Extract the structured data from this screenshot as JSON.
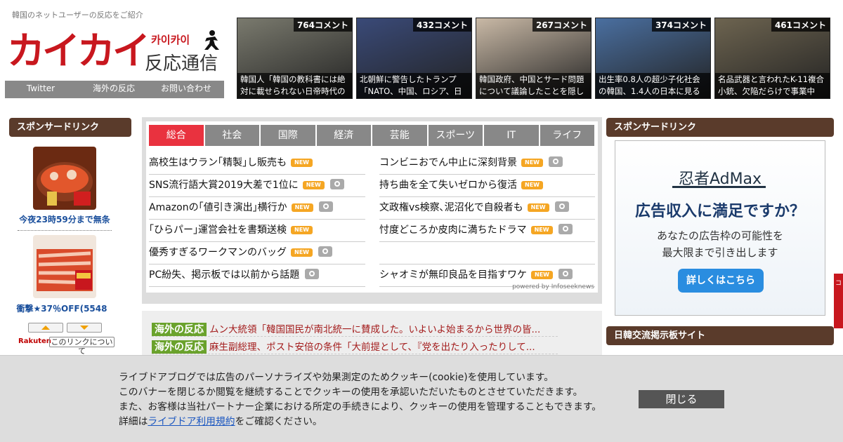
{
  "site": {
    "tagline": "韓国のネットユーザーの反応をご紹介",
    "logo_main": "カイカイ",
    "logo_kana": "카이카이",
    "logo_sub": "反応通信"
  },
  "topnav": [
    "Twitter",
    "海外の反応",
    "お問い合わせ"
  ],
  "thumbnails": [
    {
      "count": "764コメント",
      "caption": "韓国人「韓国の教科書には絶対に載せられない日帝時代の",
      "color": "#7a7a6e"
    },
    {
      "count": "432コメント",
      "caption": "北朝鮮に警告したトランプ「NATO、中国、ロシア、日",
      "color": "#3a4a78"
    },
    {
      "count": "267コメント",
      "caption": "韓国政府、中国とサード問題について議論したことを隠し",
      "color": "#c9b9a6"
    },
    {
      "count": "374コメント",
      "caption": "出生率0.8人の超少子化社会の韓国、1.4人の日本に見る",
      "color": "#4a6fa0"
    },
    {
      "count": "461コメント",
      "caption": "名品武器と言われたK-11複合小銃、欠陥だらけで事業中",
      "color": "#6d6450"
    }
  ],
  "left": {
    "header": "スポンサードリンク",
    "product1_label": "今夜23時59分まで無条",
    "product2_label": "衝撃★37％OFF(5548",
    "rakuten": "Rakuten",
    "about_link": "このリンクについて"
  },
  "news": {
    "tabs": [
      "総合",
      "社会",
      "国際",
      "経済",
      "芸能",
      "スポーツ",
      "IT",
      "ライフ"
    ],
    "active_tab": 0,
    "left_items": [
      {
        "title": "高校生はウラン｢精製｣し販売も",
        "new": true,
        "photo": false
      },
      {
        "title": "SNS流行語大賞2019大差で1位に",
        "new": true,
        "photo": true
      },
      {
        "title": "Amazonの｢値引き演出｣横行か",
        "new": true,
        "photo": true
      },
      {
        "title": "｢ひらパー｣運営会社を書類送検",
        "new": true,
        "photo": false
      },
      {
        "title": "優秀すぎるワークマンのバッグ",
        "new": true,
        "photo": true
      },
      {
        "title": "PC紛失、掲示板では以前から話題",
        "new": false,
        "photo": true
      }
    ],
    "right_items": [
      {
        "title": "コンビニおでん中止に深刻背景",
        "new": true,
        "photo": true
      },
      {
        "title": "持ち曲を全て失いゼロから復活",
        "new": true,
        "photo": false
      },
      {
        "title": "文政権vs検察､泥沼化で自殺者も",
        "new": true,
        "photo": true
      },
      {
        "title": "忖度どころか皮肉に満ちたドラマ",
        "new": true,
        "photo": true
      },
      {
        "title": "",
        "new": false,
        "photo": false
      },
      {
        "title": "シャオミが無印良品を目指すワケ",
        "new": true,
        "photo": true
      }
    ],
    "new_label": "NEW",
    "powered": "powered by Infoseeknews"
  },
  "overseas": [
    {
      "tag": "海外の反応",
      "text": "ムン大統領「韓国国民が南北統一に賛成した。いよいよ始まるから世界の皆..."
    },
    {
      "tag": "海外の反応",
      "text": "麻生副総理、ポスト安倍の条件「大前提として、『党を出たり入ったりして..."
    }
  ],
  "right": {
    "header1": "スポンサードリンク",
    "ad_brand": "忍者AdMax",
    "ad_title": "広告収入に満足ですか？",
    "ad_body1": "あなたの広告枠の可能性を",
    "ad_body2": "最大限まで引き出します",
    "ad_button": "詳しくはこちら",
    "header2": "日韓交流掲示板サイト",
    "side_tab": "コ"
  },
  "cookie": {
    "line1": "ライブドアブログでは広告のパーソナライズや効果測定のためクッキー(cookie)を使用しています。",
    "line2": "このバナーを閉じるか閲覧を継続することでクッキーの使用を承認いただいたものとさせていただきます。",
    "line3": "また、お客様は当社パートナー企業における所定の手続きにより、クッキーの使用を管理することもできます。",
    "line4_prefix": "詳細は",
    "line4_link": "ライブドア利用規約",
    "line4_suffix": "をご確認ください。",
    "close": "閉じる"
  },
  "colors": {
    "brand_red": "#c8171e",
    "section_brown": "#5a3b2b",
    "tab_active": "#e9323f",
    "tab_inactive": "#888888",
    "overseas_green": "#6aa22c",
    "new_badge": "#f5a623"
  }
}
